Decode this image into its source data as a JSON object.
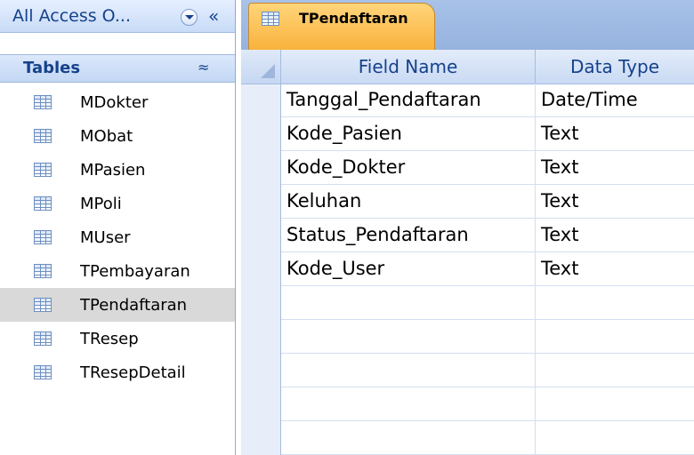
{
  "navigation_pane": {
    "title": "All Access O...",
    "shutter_glyph": "«",
    "group": {
      "title": "Tables",
      "collapse_glyph": "≈"
    },
    "items": [
      {
        "label": "MDokter",
        "icon": "table-icon"
      },
      {
        "label": "MObat",
        "icon": "table-icon"
      },
      {
        "label": "MPasien",
        "icon": "table-icon"
      },
      {
        "label": "MPoli",
        "icon": "table-icon"
      },
      {
        "label": "MUser",
        "icon": "table-icon"
      },
      {
        "label": "TPembayaran",
        "icon": "table-icon"
      },
      {
        "label": "TPendaftaran",
        "icon": "table-icon",
        "selected": true
      },
      {
        "label": "TResep",
        "icon": "table-icon"
      },
      {
        "label": "TResepDetail",
        "icon": "table-icon"
      }
    ]
  },
  "document": {
    "active_tab": "TPendaftaran",
    "tab_color": "#f9b13b",
    "design_grid": {
      "columns": [
        "Field Name",
        "Data Type"
      ],
      "rows": [
        {
          "field_name": "Tanggal_Pendaftaran",
          "data_type": "Date/Time"
        },
        {
          "field_name": "Kode_Pasien",
          "data_type": "Text"
        },
        {
          "field_name": "Kode_Dokter",
          "data_type": "Text"
        },
        {
          "field_name": "Keluhan",
          "data_type": "Text"
        },
        {
          "field_name": "Status_Pendaftaran",
          "data_type": "Text"
        },
        {
          "field_name": "Kode_User",
          "data_type": "Text"
        },
        {
          "field_name": "",
          "data_type": ""
        },
        {
          "field_name": "",
          "data_type": ""
        },
        {
          "field_name": "",
          "data_type": ""
        },
        {
          "field_name": "",
          "data_type": ""
        },
        {
          "field_name": "",
          "data_type": ""
        }
      ]
    }
  }
}
